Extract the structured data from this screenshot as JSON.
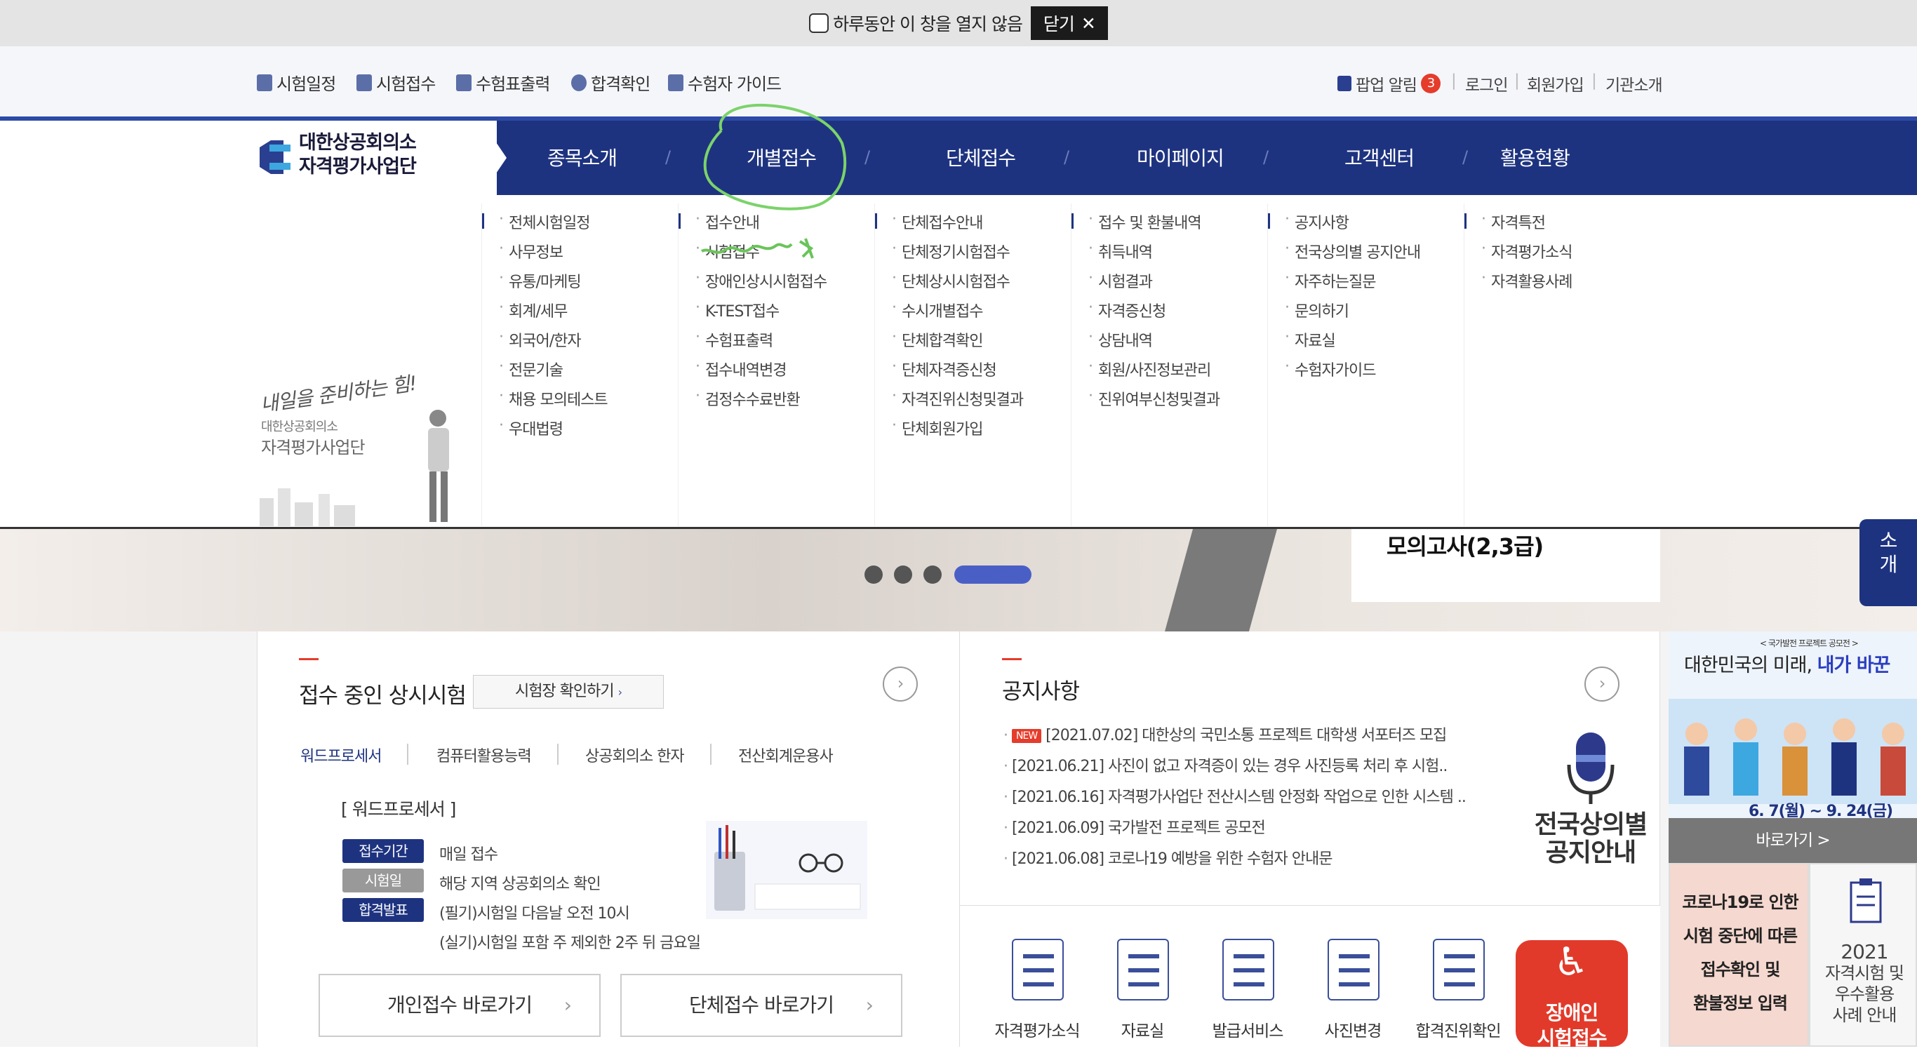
{
  "popup_bar": {
    "dont_open_label": "하루동안 이 창을 열지 않음",
    "close_label": "닫기"
  },
  "util_nav": {
    "left": [
      "시험일정",
      "시험접수",
      "수험표출력",
      "합격확인",
      "수험자 가이드"
    ],
    "popup_alert": "팝업 알림",
    "popup_count": "3",
    "login": "로그인",
    "signup": "회원가입",
    "about": "기관소개"
  },
  "logo": {
    "line1": "대한상공회의소",
    "line2": "자격평가사업단"
  },
  "gnb": [
    "종목소개",
    "개별접수",
    "단체접수",
    "마이페이지",
    "고객센터",
    "활용현황"
  ],
  "submenus": [
    [
      "전체시험일정",
      "사무정보",
      "유통/마케팅",
      "회계/세무",
      "외국어/한자",
      "전문기술",
      "채용 모의테스트",
      "우대법령"
    ],
    [
      "접수안내",
      "시험접수",
      "장애인상시시험접수",
      "K-TEST접수",
      "수험표출력",
      "접수내역변경",
      "검정수수료반환"
    ],
    [
      "단체접수안내",
      "단체정기시험접수",
      "단체상시시험접수",
      "수시개별접수",
      "단체합격확인",
      "단체자격증신청",
      "자격진위신청및결과",
      "단체회원가입"
    ],
    [
      "접수 및 환불내역",
      "취득내역",
      "시험결과",
      "자격증신청",
      "상담내역",
      "회원/사진정보관리",
      "진위여부신청및결과"
    ],
    [
      "공지사항",
      "전국상의별 공지안내",
      "자주하는질문",
      "문의하기",
      "자료실",
      "수험자가이드"
    ],
    [
      "자격특전",
      "자격평가소식",
      "자격활용사례"
    ]
  ],
  "left_promo": {
    "slogan": "내일을 준비하는 힘!",
    "org1": "대한상공회의소",
    "org2": "자격평가사업단"
  },
  "banner": {
    "card_text": "모의고사(2,3급)",
    "side_tab": "소\n개"
  },
  "exam_panel": {
    "title": "접수 중인 상시시험",
    "venue_button": "시험장 확인하기",
    "tabs": [
      "워드프로세서",
      "컴퓨터활용능력",
      "상공회의소 한자",
      "전산회계운용사"
    ],
    "selected_heading": "[ 워드프로세서 ]",
    "rows": [
      {
        "label": "접수기간",
        "text": "매일 접수",
        "color": "#1e3380"
      },
      {
        "label": "시험일",
        "text": "해당 지역 상공회의소 확인",
        "color": "#999999"
      },
      {
        "label": "합격발표",
        "text": "(필기)시험일 다음날 오전 10시",
        "color": "#1e3380"
      },
      {
        "label": "",
        "text": "(실기)시험일 포함 주 제외한 2주 뒤 금요일",
        "color": ""
      }
    ],
    "btn_individual": "개인접수 바로가기",
    "btn_group": "단체접수 바로가기"
  },
  "notice_panel": {
    "title": "공지사항",
    "new_badge": "NEW",
    "items": [
      "[2021.07.02] 대한상의 국민소통 프로젝트 대학생 서포터즈 모집",
      "[2021.06.21] 사진이 없고 자격증이 있는 경우 사진등록 처리 후 시험..",
      "[2021.06.16] 자격평가사업단 전산시스템 안정화 작업으로 인한 시스템 ..",
      "[2021.06.09] 국가발전 프로젝트 공모전",
      "[2021.06.08] 코로나19 예방을 위한 수험자 안내문"
    ],
    "side_label1": "전국상의별",
    "side_label2": "공지안내"
  },
  "quick_links": [
    "자격평가소식",
    "자료실",
    "발급서비스",
    "사진변경",
    "합격진위확인"
  ],
  "disabled_btn": {
    "line1": "장애인",
    "line2": "시험접수"
  },
  "right_banner": {
    "top": "< 국가발전 프로젝트 공모전 >",
    "title_a": "대한민국의 미래, ",
    "title_b": "내가 바꾼",
    "dates": "6. 7(월) ~ 9. 24(금)",
    "go": "바로가기 >"
  },
  "covid": {
    "l1": "코로나19로 인한",
    "l2": "시험 중단에 따른",
    "l3": "접수확인 및",
    "l4": "환불정보 입력"
  },
  "covid_b": {
    "l1": "2021",
    "l2": "자격시험 및",
    "l3": "우수활용",
    "l4": "사례 안내"
  },
  "colors": {
    "navy": "#1e3380",
    "accent_red": "#e53c2b",
    "annotation_green": "#7bd36a"
  }
}
